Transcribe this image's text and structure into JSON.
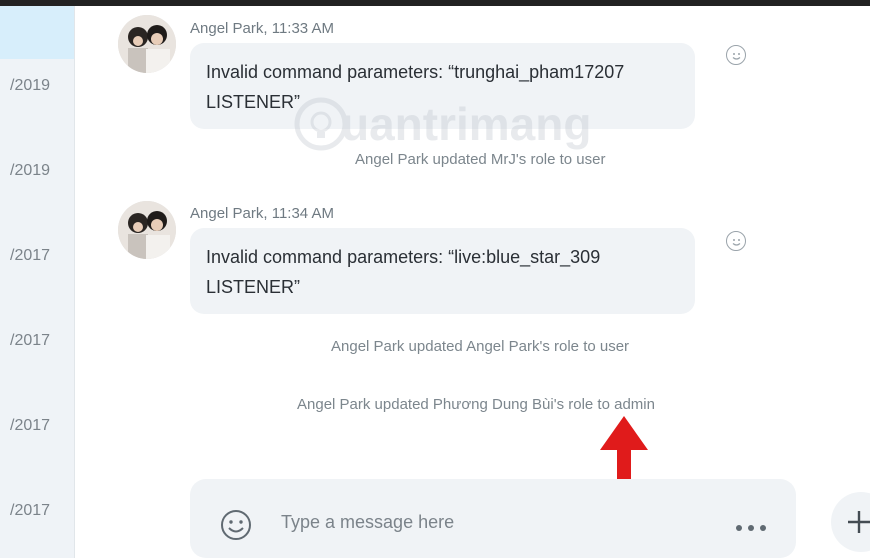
{
  "sidebar": {
    "dates": [
      "/2019",
      "/2019",
      "/2017",
      "/2017",
      "/2017",
      "/2017"
    ]
  },
  "messages": [
    {
      "sender": "Angel Park, 11:33 AM",
      "text": "Invalid command parameters: “trunghai_pham17207\nLISTENER”"
    },
    {
      "sender": "Angel Park, 11:34 AM",
      "text": "Invalid command parameters: “live:blue_star_309\nLISTENER”"
    }
  ],
  "system_messages": [
    "Angel Park updated MrJ's role to user",
    "Angel Park updated Angel Park's role to user",
    "Angel Park updated Phương Dung Bùi's role to admin"
  ],
  "watermark": "uantrimang",
  "composer": {
    "placeholder": "Type a message here"
  },
  "icons": {
    "emoji": "smiley-icon",
    "more": "more-icon",
    "add": "plus-icon"
  },
  "colors": {
    "arrow": "#e01b1b",
    "bubble": "#f0f3f6",
    "selected": "#d7eefb"
  }
}
